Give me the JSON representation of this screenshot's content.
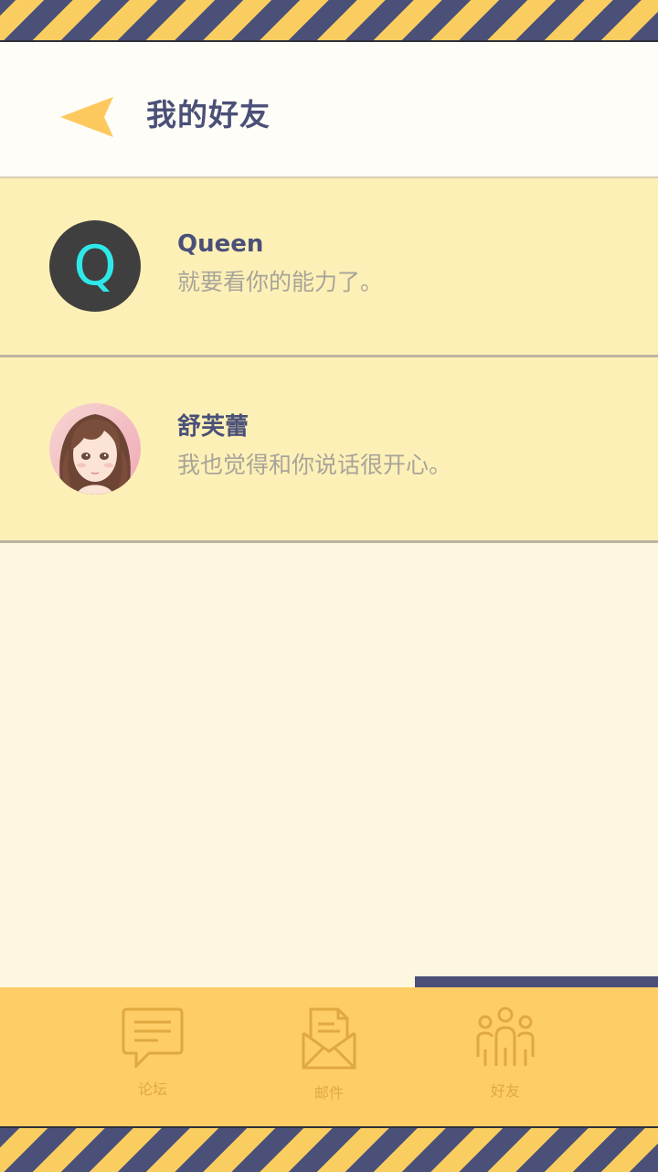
{
  "header": {
    "title": "我的好友",
    "back_icon": "back-arrow-icon"
  },
  "friends": [
    {
      "name": "Queen",
      "avatar_letter": "Q",
      "avatar_bg": "#3f3f3f",
      "avatar_fg": "#2ee8ea",
      "message": "就要看你的能力了。"
    },
    {
      "name": "舒芙蕾",
      "avatar_icon": "girl-portrait-avatar",
      "message": "我也觉得和你说话很开心。"
    }
  ],
  "tabs": [
    {
      "label": "论坛",
      "icon": "chat-bubble-icon"
    },
    {
      "label": "邮件",
      "icon": "mail-icon"
    },
    {
      "label": "好友",
      "icon": "friends-icon",
      "active": true
    }
  ],
  "colors": {
    "accent": "#fecd65",
    "navy": "#4a5078",
    "row_bg": "#fdf0b6",
    "page_bg": "#fdf7e0",
    "muted_text": "#a8a49a",
    "tab_icon": "#e0a940"
  }
}
